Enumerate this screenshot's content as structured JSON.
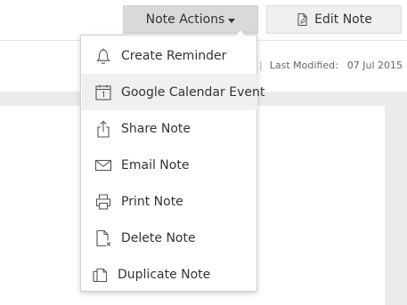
{
  "toolbar": {
    "note_actions_label": "Note Actions",
    "edit_note_label": "Edit Note"
  },
  "meta": {
    "separator": "|",
    "last_modified_label": "Last Modified:",
    "last_modified_value": "07 Jul 2015"
  },
  "menu": {
    "items": [
      {
        "label": "Create Reminder",
        "icon": "bell-icon"
      },
      {
        "label": "Google Calendar Event",
        "icon": "calendar-icon"
      },
      {
        "label": "Share Note",
        "icon": "share-icon"
      },
      {
        "label": "Email Note",
        "icon": "envelope-icon"
      },
      {
        "label": "Print Note",
        "icon": "printer-icon"
      },
      {
        "label": "Delete Note",
        "icon": "delete-document-icon"
      },
      {
        "label": "Duplicate Note",
        "icon": "duplicate-icon"
      }
    ]
  },
  "colors": {
    "actions_button_bg": "#d9d9d9",
    "edit_button_bg": "#efefef",
    "hover_item_bg": "#f0f0f0",
    "panel_bg": "#ebebeb"
  }
}
